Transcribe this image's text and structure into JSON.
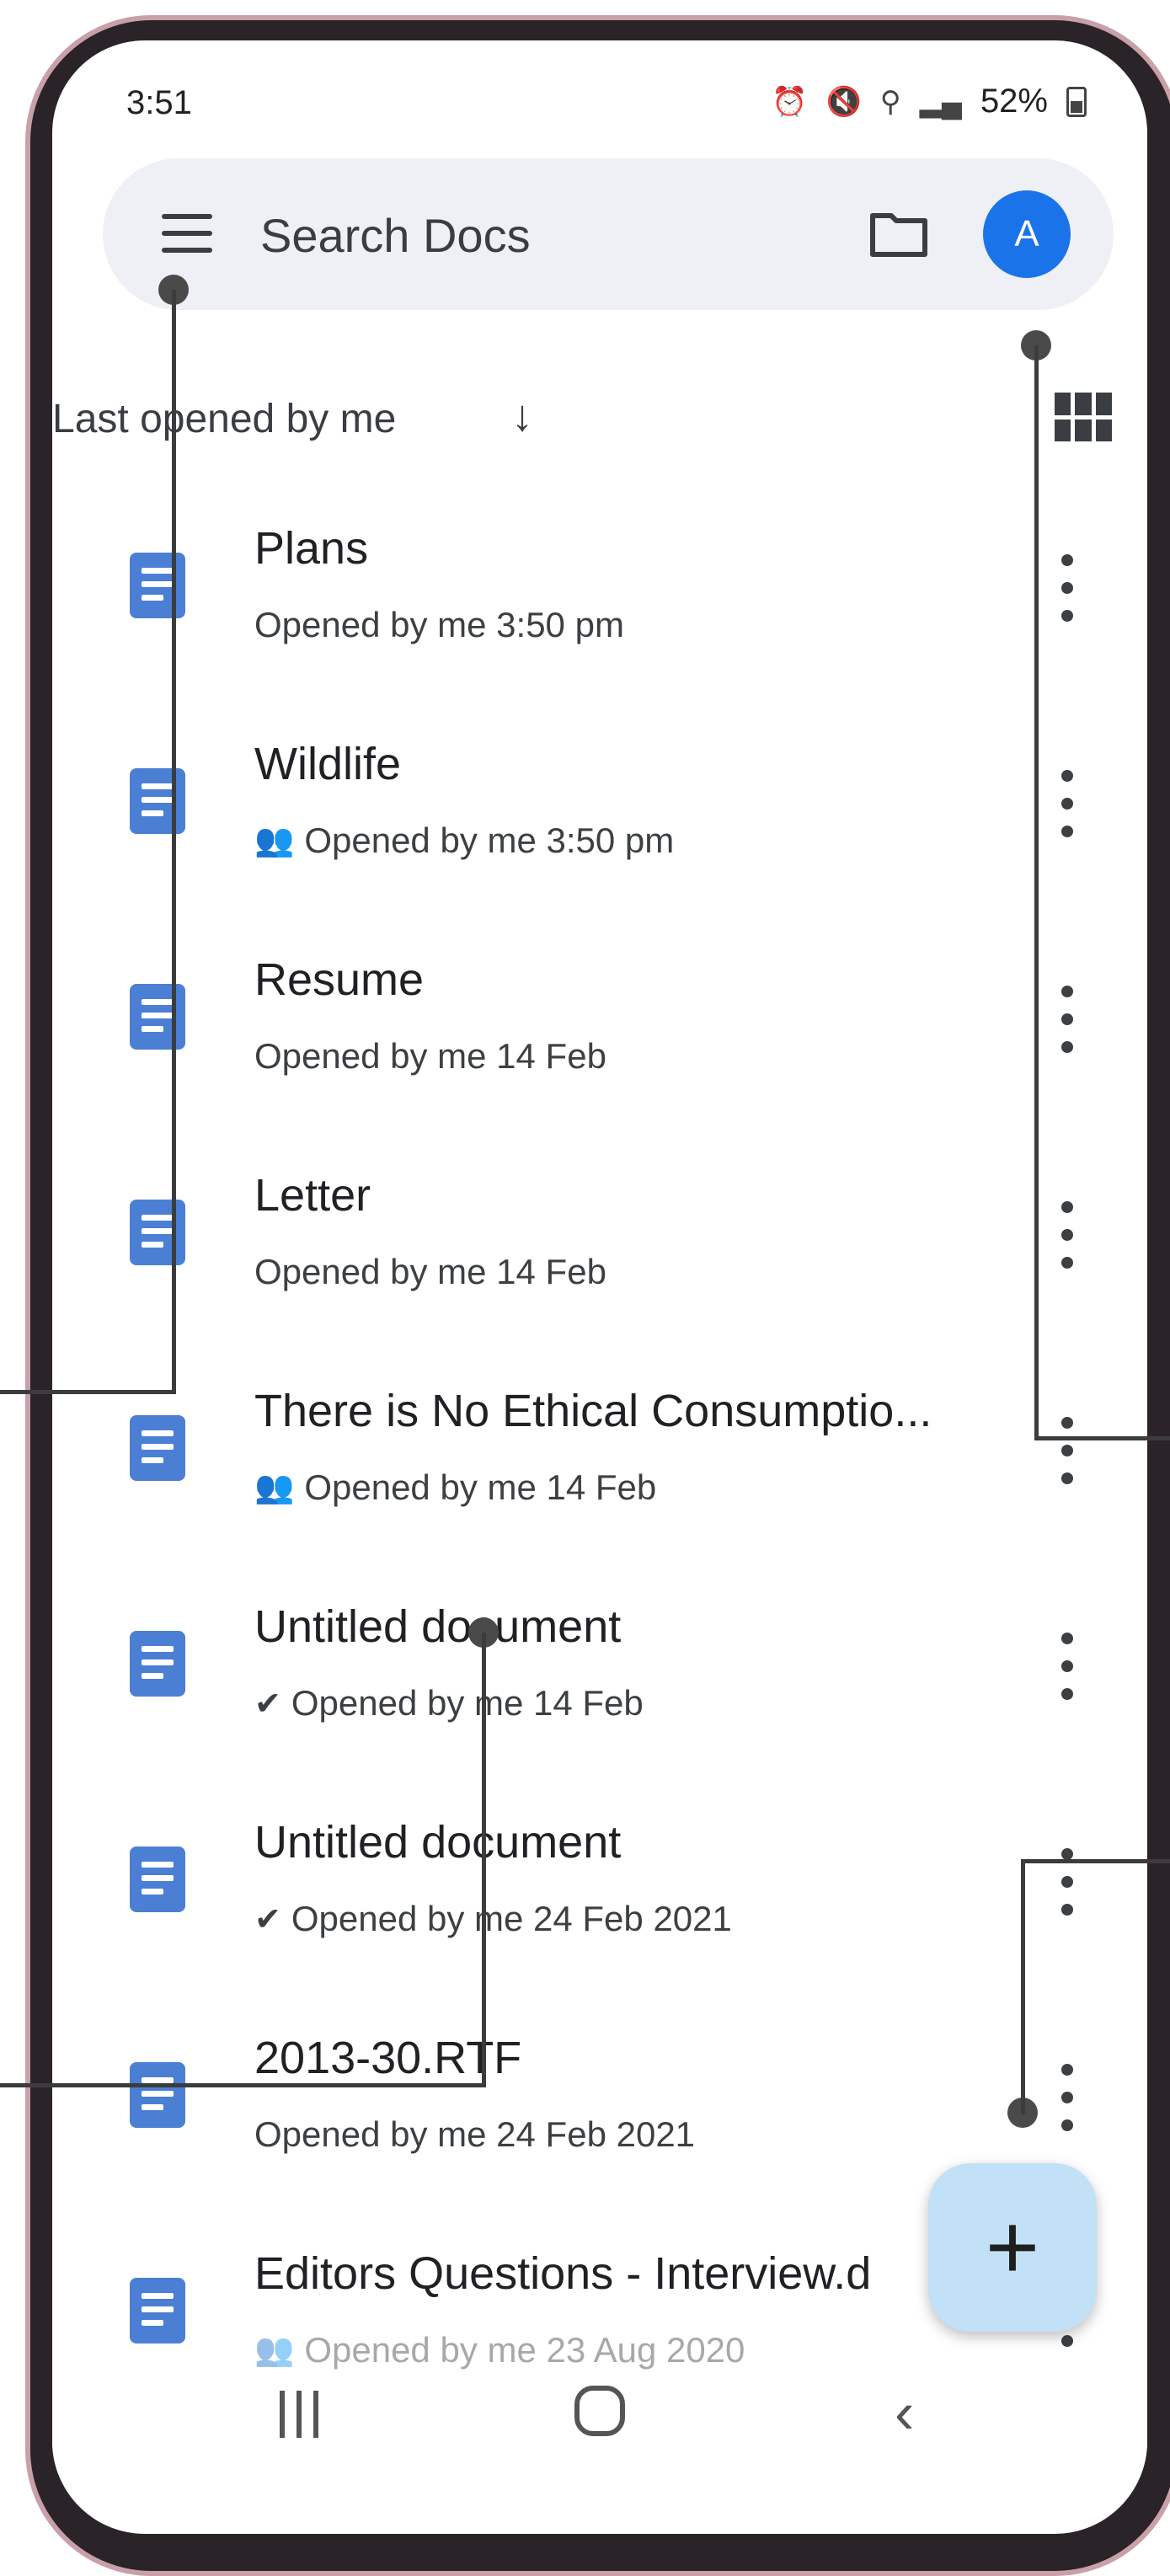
{
  "status_bar": {
    "time": "3:51",
    "icons": [
      "alarm-icon",
      "mute-icon",
      "location-icon",
      "signal-icon"
    ],
    "battery": "52%"
  },
  "search": {
    "placeholder": "Search Docs",
    "avatar_letter": "A"
  },
  "sort": {
    "label": "Last opened by me",
    "arrow": "↓"
  },
  "documents": [
    {
      "title": "Plans",
      "subtitle": "Opened by me 3:50 pm",
      "status_icon": ""
    },
    {
      "title": "Wildlife",
      "subtitle": "Opened by me 3:50 pm",
      "status_icon": "shared-icon"
    },
    {
      "title": "Resume",
      "subtitle": "Opened by me 14 Feb",
      "status_icon": ""
    },
    {
      "title": "Letter",
      "subtitle": "Opened by me 14 Feb",
      "status_icon": ""
    },
    {
      "title": "There is No Ethical Consumptio...",
      "subtitle": "Opened by me 14 Feb",
      "status_icon": "shared-icon"
    },
    {
      "title": "Untitled document",
      "subtitle": "Opened by me 14 Feb",
      "status_icon": "offline-icon"
    },
    {
      "title": "Untitled document",
      "subtitle": "Opened by me 24 Feb 2021",
      "status_icon": "offline-icon"
    },
    {
      "title": "2013-30.RTF",
      "subtitle": "Opened by me 24 Feb 2021",
      "status_icon": ""
    },
    {
      "title": "Editors Questions - Interview.d",
      "subtitle": "Opened by me 23 Aug 2020",
      "status_icon": "shared-icon"
    }
  ],
  "fab": {
    "label": "+"
  },
  "colors": {
    "accent": "#1a73e8",
    "doc_icon": "#4a7fd4",
    "search_bg": "#eef0f5",
    "fab_bg": "#c2e1f7"
  }
}
